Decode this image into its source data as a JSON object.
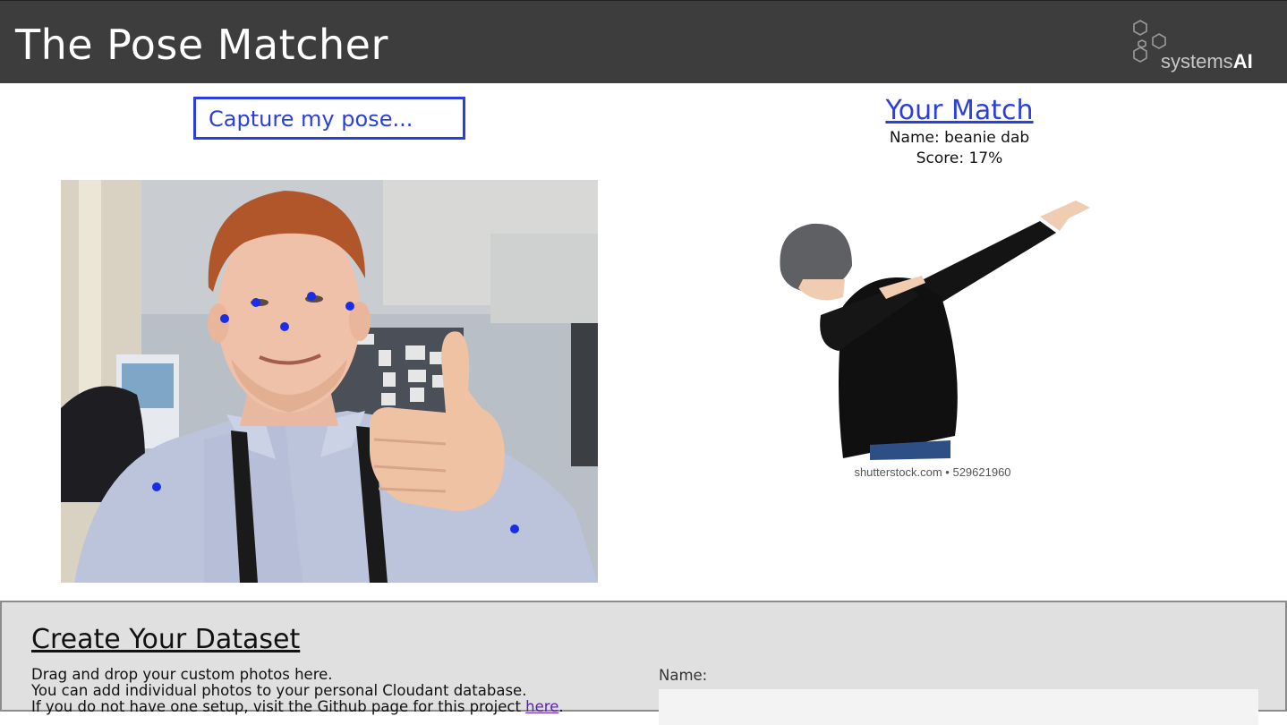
{
  "header": {
    "title": "The Pose Matcher",
    "logo": {
      "text_light": "systems",
      "text_bold": "AI"
    }
  },
  "capture": {
    "button_label": "Capture my pose..."
  },
  "match": {
    "title": "Your Match",
    "name_line": "Name: beanie dab",
    "score_line": "Score: 17%",
    "image_watermark": "shutterstock.com • 529621960"
  },
  "dataset": {
    "title": "Create Your Dataset",
    "line1": "Drag and drop your custom photos here.",
    "line2": "You can add individual photos to your personal Cloudant database.",
    "line3_prefix": "If you do not have one setup, visit the Github page for this project ",
    "line3_link": "here",
    "line3_suffix": ".",
    "name_label": "Name:",
    "name_value": ""
  },
  "colors": {
    "accent": "#2b3fe0",
    "header_bg": "#3d3d3d",
    "panel_bg": "#e0e0e0",
    "keypoint": "#1a2ee8"
  }
}
